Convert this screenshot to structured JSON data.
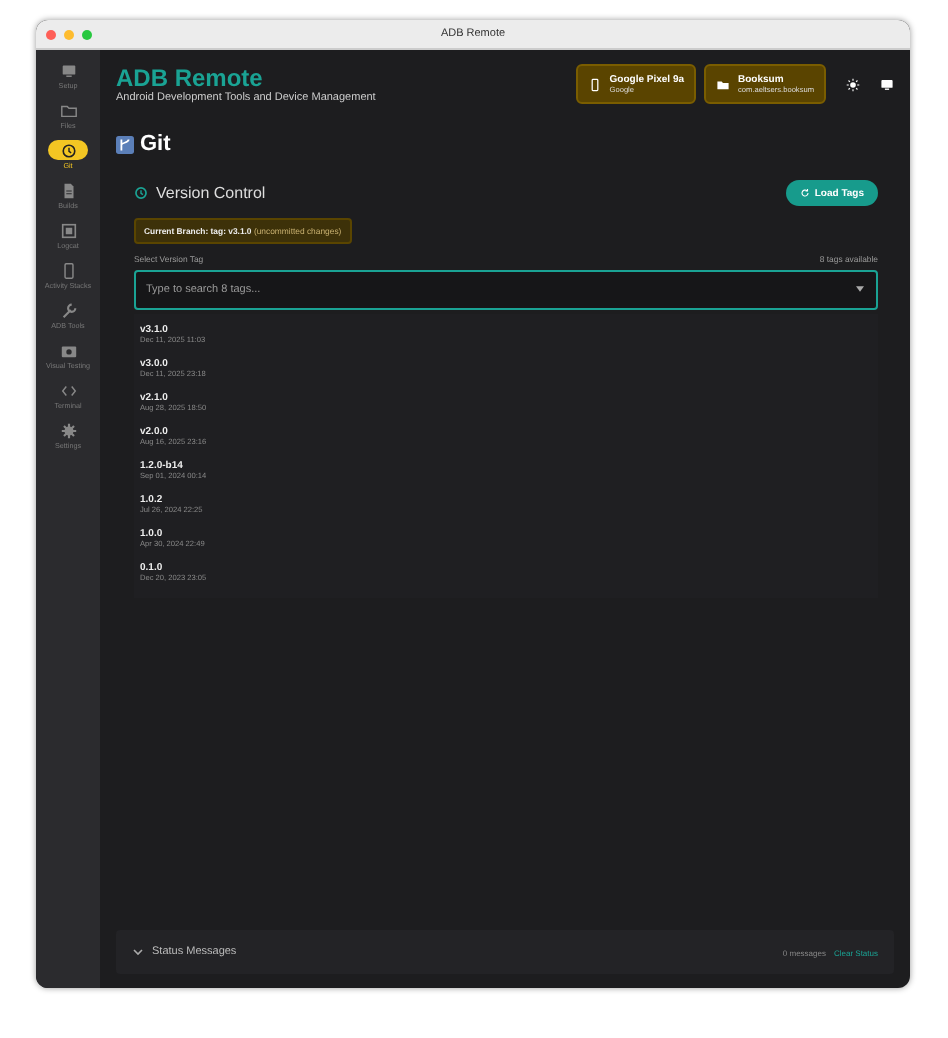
{
  "window": {
    "title": "ADB Remote"
  },
  "sidebar": {
    "items": [
      {
        "label": "Setup",
        "selected": false
      },
      {
        "label": "Files",
        "selected": false
      },
      {
        "label": "Git",
        "selected": true
      },
      {
        "label": "Builds",
        "selected": false
      },
      {
        "label": "Logcat",
        "selected": false
      },
      {
        "label": "Activity Stacks",
        "selected": false
      },
      {
        "label": "ADB Tools",
        "selected": false
      },
      {
        "label": "Visual Testing",
        "selected": false
      },
      {
        "label": "Terminal",
        "selected": false
      },
      {
        "label": "Settings",
        "selected": false
      }
    ]
  },
  "header": {
    "title": "ADB Remote",
    "subtitle": "Android Development Tools and Device Management",
    "chips": [
      {
        "kind": "device",
        "title": "Google Pixel 9a",
        "subtitle": "Google"
      },
      {
        "kind": "app",
        "title": "Booksum",
        "subtitle": "com.aeltsers.booksum"
      }
    ]
  },
  "page": {
    "title": "Git"
  },
  "version_control": {
    "title": "Version Control",
    "load_button": "Load Tags",
    "branch": {
      "label": "Current Branch:",
      "value": "tag: v3.1.0",
      "note": "(uncommitted changes)"
    },
    "select_label": "Select Version Tag",
    "count": "8 tags available",
    "placeholder": "Type to search 8 tags...",
    "tags": [
      {
        "name": "v3.1.0",
        "date": "Dec 11, 2025 11:03"
      },
      {
        "name": "v3.0.0",
        "date": "Dec 11, 2025 23:18"
      },
      {
        "name": "v2.1.0",
        "date": "Aug 28, 2025 18:50"
      },
      {
        "name": "v2.0.0",
        "date": "Aug 16, 2025 23:16"
      },
      {
        "name": "1.2.0-b14",
        "date": "Sep 01, 2024 00:14"
      },
      {
        "name": "1.0.2",
        "date": "Jul 26, 2024 22:25"
      },
      {
        "name": "1.0.0",
        "date": "Apr 30, 2024 22:49"
      },
      {
        "name": "0.1.0",
        "date": "Dec 20, 2023 23:05"
      }
    ]
  },
  "status_bar": {
    "title": "Status Messages",
    "expanded": false,
    "count": "0 messages",
    "clear": "Clear Status"
  }
}
